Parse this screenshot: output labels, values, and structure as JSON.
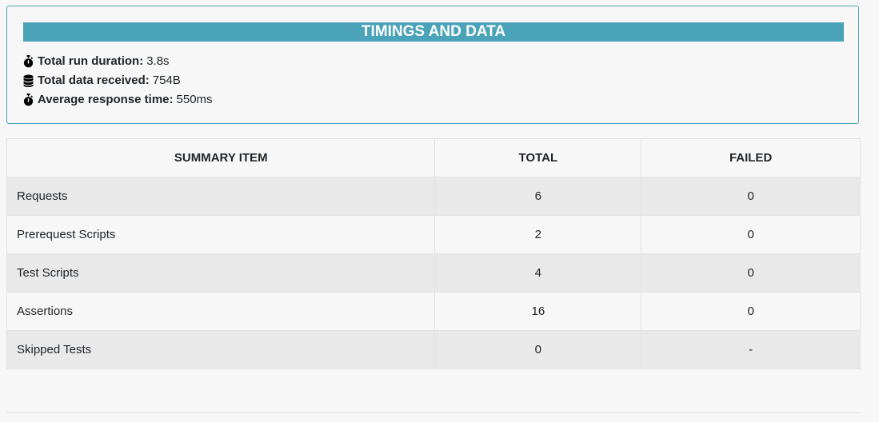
{
  "timings": {
    "title": "TIMINGS AND DATA",
    "stats": [
      {
        "icon": "stopwatch-icon",
        "label": "Total run duration:",
        "value": "3.8s"
      },
      {
        "icon": "database-icon",
        "label": "Total data received:",
        "value": "754B"
      },
      {
        "icon": "stopwatch-icon",
        "label": "Average response time:",
        "value": "550ms"
      }
    ]
  },
  "summary": {
    "headers": [
      "SUMMARY ITEM",
      "TOTAL",
      "FAILED"
    ],
    "rows": [
      {
        "item": "Requests",
        "total": "6",
        "failed": "0"
      },
      {
        "item": "Prerequest Scripts",
        "total": "2",
        "failed": "0"
      },
      {
        "item": "Test Scripts",
        "total": "4",
        "failed": "0"
      },
      {
        "item": "Assertions",
        "total": "16",
        "failed": "0"
      },
      {
        "item": "Skipped Tests",
        "total": "0",
        "failed": "-"
      }
    ]
  },
  "colors": {
    "accent": "#4aa3b8",
    "page_bg": "#f7f7f7",
    "row_alt": "#e9e9e9"
  }
}
